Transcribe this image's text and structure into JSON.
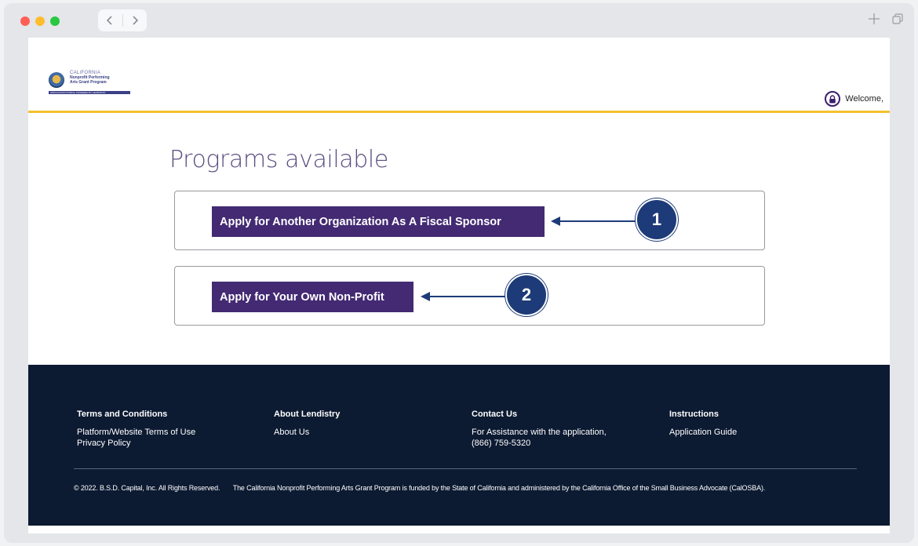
{
  "browser": {
    "back_icon": "chevron-left-icon",
    "forward_icon": "chevron-right-icon",
    "new_tab_icon": "plus-icon",
    "tabs_icon": "tabs-overview-icon"
  },
  "header": {
    "logo": {
      "line1": "CALIFORNIA",
      "line2": "Nonprofit Performing",
      "line3": "Arts Grant Program",
      "strip": "APPLICATION PORTAL POWERED BY LENDISTRY"
    },
    "welcome_text": "Welcome,",
    "accent_color": "#f2c12e"
  },
  "main": {
    "title": "Programs available",
    "programs": [
      {
        "label": "Apply for Another Organization As A Fiscal Sponsor",
        "callout": "1"
      },
      {
        "label": "Apply for Your Own Non-Profit",
        "callout": "2"
      }
    ],
    "button_color": "#432a73",
    "callout_color": "#1d3b78"
  },
  "footer": {
    "columns": [
      {
        "heading": "Terms and Conditions",
        "links": [
          "Platform/Website Terms of Use",
          "Privacy Policy"
        ]
      },
      {
        "heading": "About Lendistry",
        "links": [
          "About Us"
        ]
      },
      {
        "heading": "Contact Us",
        "links": [
          "For Assistance with the application,",
          "(866) 759-5320"
        ]
      },
      {
        "heading": "Instructions",
        "links": [
          "Application Guide"
        ]
      }
    ],
    "copyright": "© 2022. B.S.D. Capital, Inc. All Rights Reserved.",
    "funding_note": "The California Nonprofit Performing Arts Grant Program is funded by the State of California and administered by the California Office of the Small Business Advocate (CalOSBA).",
    "background_color": "#0c1a32"
  }
}
